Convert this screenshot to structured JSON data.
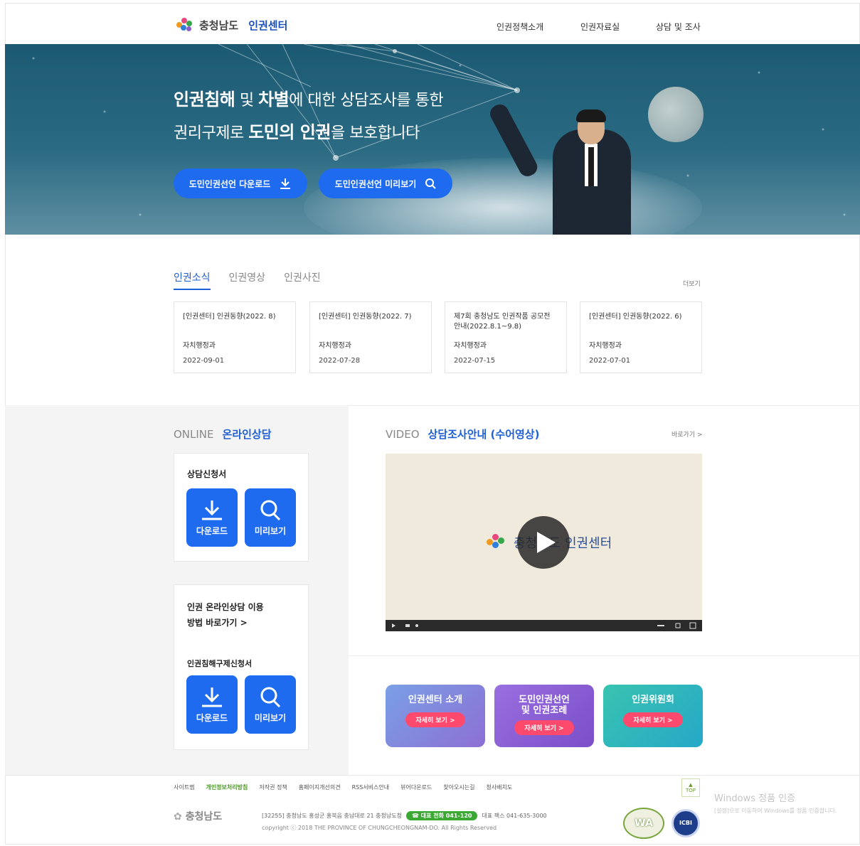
{
  "header": {
    "logo_text": "충청남도",
    "logo_sub": "인권센터",
    "nav": [
      "인권정책소개",
      "인권자료실",
      "상담 및 조사"
    ]
  },
  "hero": {
    "line1_b1": "인권침해",
    "line1_t1": " 및 ",
    "line1_b2": "차별",
    "line1_t2": "에 대한 상담조사를 통한",
    "line2_t1": "권리구제로 ",
    "line2_b1": "도민의 인권",
    "line2_t2": "을 보호합니다",
    "btn_download": "도민인권선언 다운로드",
    "btn_preview": "도민인권선언 미리보기"
  },
  "news": {
    "tabs": [
      "인권소식",
      "인권영상",
      "인권사진"
    ],
    "more": "더보기",
    "cards": [
      {
        "title": "[인권센터] 인권동향(2022. 8)",
        "author": "자치행정과",
        "date": "2022-09-01"
      },
      {
        "title": "[인권센터] 인권동향(2022. 7)",
        "author": "자치행정과",
        "date": "2022-07-28"
      },
      {
        "title": "제7회 충청남도 인권작품 공모전 안내(2022.8.1~9.8)",
        "author": "자치행정과",
        "date": "2022-07-15"
      },
      {
        "title": "[인권센터] 인권동향(2022. 6)",
        "author": "자치행정과",
        "date": "2022-07-01"
      }
    ]
  },
  "online": {
    "en": "ONLINE",
    "ko": "온라인상담",
    "panel1_title": "상담신청서",
    "download": "다운로드",
    "preview": "미리보기",
    "guide_line1": "인권 온라인상담 이용",
    "guide_line2": "방법 바로가기 >",
    "panel2_title": "인권침해구제신청서"
  },
  "video": {
    "en": "VIDEO",
    "ko": "상담조사안내 (수어영상)",
    "more": "바로가기 >",
    "logo_text": "충청남도 인권센터"
  },
  "banners": [
    {
      "title": "인권센터 소개",
      "btn": "자세히 보기 >",
      "color": "#6f86d6"
    },
    {
      "title": "도민인권선언\n및 인권조례",
      "btn": "자세히 보기 >",
      "color": "#8a5cd0"
    },
    {
      "title": "인권위원회",
      "btn": "자세히 보기 >",
      "color": "#2ab9b0"
    }
  ],
  "footer": {
    "links": [
      "사이트맵",
      "개인정보처리방침",
      "저작권 정책",
      "홈페이지개선의견",
      "RSS서비스안내",
      "뷰어다운로드",
      "찾아오시는길",
      "청사배치도"
    ],
    "top": "TOP",
    "logo": "충청남도",
    "address": "[32255] 충청남도 홍성군 홍북읍 충남대로 21 충청남도청",
    "phone": "☎ 대표 전화 041-120",
    "fax": "대표 팩스 041-635-3000",
    "copyright": "copyright ⓒ 2018 THE PROVINCE OF CHUNGCHEONGNAM-DO. All Rights Reserved",
    "wa": "WA",
    "icbi": "ICBI"
  },
  "windows": {
    "line1": "Windows 정품 인증",
    "line2": "[설정]으로 이동하여 Windows를 정품 인증합니다."
  }
}
